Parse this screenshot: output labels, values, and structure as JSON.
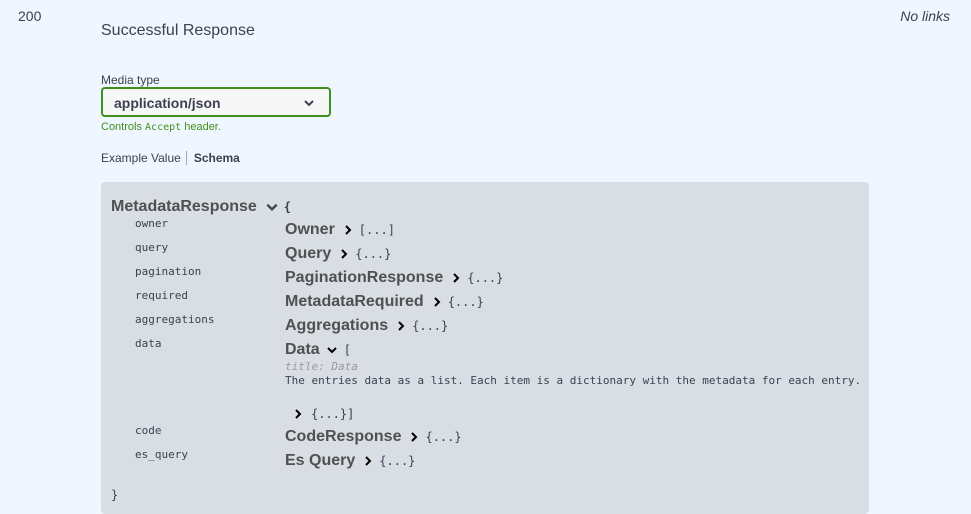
{
  "response": {
    "code": "200",
    "description": "Successful Response",
    "links": "No links"
  },
  "media_type": {
    "label": "Media type",
    "selected": "application/json",
    "controls_prefix": "Controls",
    "controls_code": "Accept",
    "controls_suffix": "header."
  },
  "tabs": {
    "example_value": "Example Value",
    "schema": "Schema"
  },
  "schema": {
    "model_name": "MetadataResponse",
    "open_brace": "{",
    "close_brace": "}",
    "properties": [
      {
        "name": "owner",
        "type": "Owner",
        "collapsed": "[...]"
      },
      {
        "name": "query",
        "type": "Query",
        "collapsed": "{...}"
      },
      {
        "name": "pagination",
        "type": "PaginationResponse",
        "collapsed": "{...}"
      },
      {
        "name": "required",
        "type": "MetadataRequired",
        "collapsed": "{...}"
      },
      {
        "name": "aggregations",
        "type": "Aggregations",
        "collapsed": "{...}"
      },
      {
        "name": "data",
        "type": "Data",
        "open": "["
      },
      {
        "name": "code",
        "type": "CodeResponse",
        "collapsed": "{...}"
      },
      {
        "name": "es_query",
        "type": "Es Query",
        "collapsed": "{...}"
      }
    ],
    "data_title": "title: Data",
    "data_description": "The entries data as a list. Each item is a dictionary with the metadata for each entry.",
    "data_items": "{...}]"
  },
  "icons": {
    "select_chevron": "chevron-down-icon",
    "expand": "chevron-right-icon",
    "collapse": "chevron-down-icon"
  }
}
